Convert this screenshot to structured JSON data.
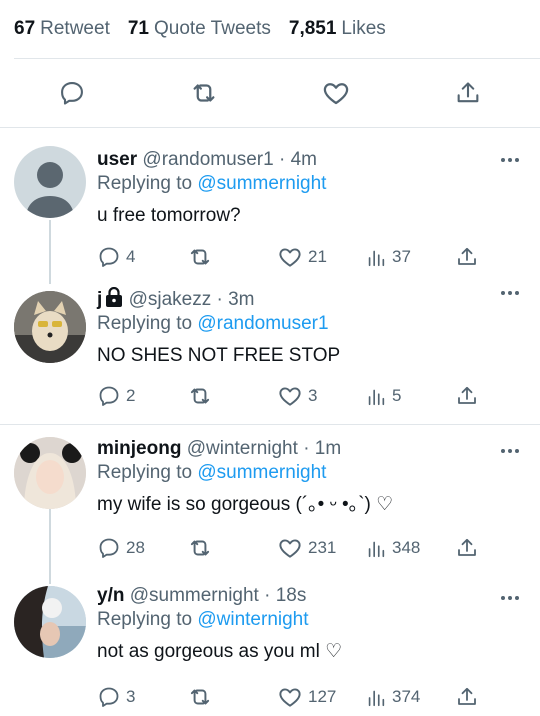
{
  "stats": {
    "retweets": {
      "count": "67",
      "label": "Retweet"
    },
    "quotes": {
      "count": "71",
      "label": "Quote Tweets"
    },
    "likes": {
      "count": "7,851",
      "label": "Likes"
    }
  },
  "action_bar_icons": [
    "reply-icon",
    "retweet-icon",
    "like-icon",
    "share-icon"
  ],
  "colors": {
    "accent": "#1d9bf0",
    "muted": "#536471",
    "text": "#0f1419",
    "divider": "#e1e6ea"
  },
  "replying_prefix": "Replying to",
  "tweets": [
    {
      "name": "user",
      "handle": "@randomuser1",
      "sep": "·",
      "time": "4m",
      "replying_to": "@summernight",
      "text": "u free tomorrow?",
      "replies": "4",
      "retweets": "",
      "likes": "21",
      "views": "37"
    },
    {
      "name": "j",
      "handle": "@sjakezz",
      "sep": "·",
      "time": "3m",
      "replying_to": "@randomuser1",
      "text": "NO SHES NOT FREE STOP",
      "replies": "2",
      "retweets": "",
      "likes": "3",
      "views": "5"
    },
    {
      "name": "minjeong",
      "handle": "@winternight",
      "sep": "·",
      "time": "1m",
      "replying_to": "@summernight",
      "text": "my wife is so gorgeous  (´｡• ᵕ •｡`) ♡",
      "replies": "28",
      "retweets": "",
      "likes": "231",
      "views": "348"
    },
    {
      "name": "y/n",
      "handle": "@summernight",
      "sep": "·",
      "time": "18s",
      "replying_to": "@winternight",
      "text": "not as gorgeous as you ml ♡",
      "replies": "3",
      "retweets": "",
      "likes": "127",
      "views": "374"
    }
  ]
}
